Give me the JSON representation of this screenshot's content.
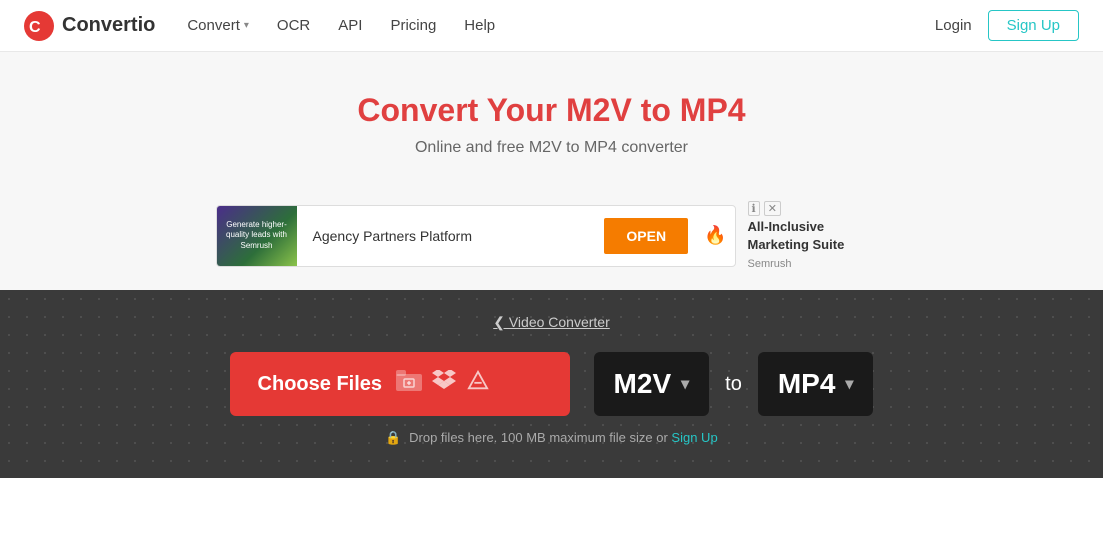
{
  "header": {
    "logo_text": "Convertio",
    "nav": [
      {
        "label": "Convert",
        "has_dropdown": true
      },
      {
        "label": "OCR",
        "has_dropdown": false
      },
      {
        "label": "API",
        "has_dropdown": false
      },
      {
        "label": "Pricing",
        "has_dropdown": false
      },
      {
        "label": "Help",
        "has_dropdown": false
      }
    ],
    "login_label": "Login",
    "signup_label": "Sign Up"
  },
  "hero": {
    "title": "Convert Your M2V to MP4",
    "subtitle": "Online and free M2V to MP4 converter"
  },
  "ad": {
    "img_text": "Generate higher-quality leads with Semrush",
    "partner_text": "Agency Partners Platform",
    "open_label": "OPEN",
    "side_title": "All-Inclusive Marketing Suite",
    "side_brand": "Semrush"
  },
  "converter": {
    "breadcrumb": "❮  Video Converter",
    "choose_files_label": "Choose Files",
    "from_format": "M2V",
    "to_label": "to",
    "to_format": "MP4",
    "drop_hint_text": "Drop files here. 100 MB maximum file size or",
    "drop_hint_link": "Sign Up"
  }
}
